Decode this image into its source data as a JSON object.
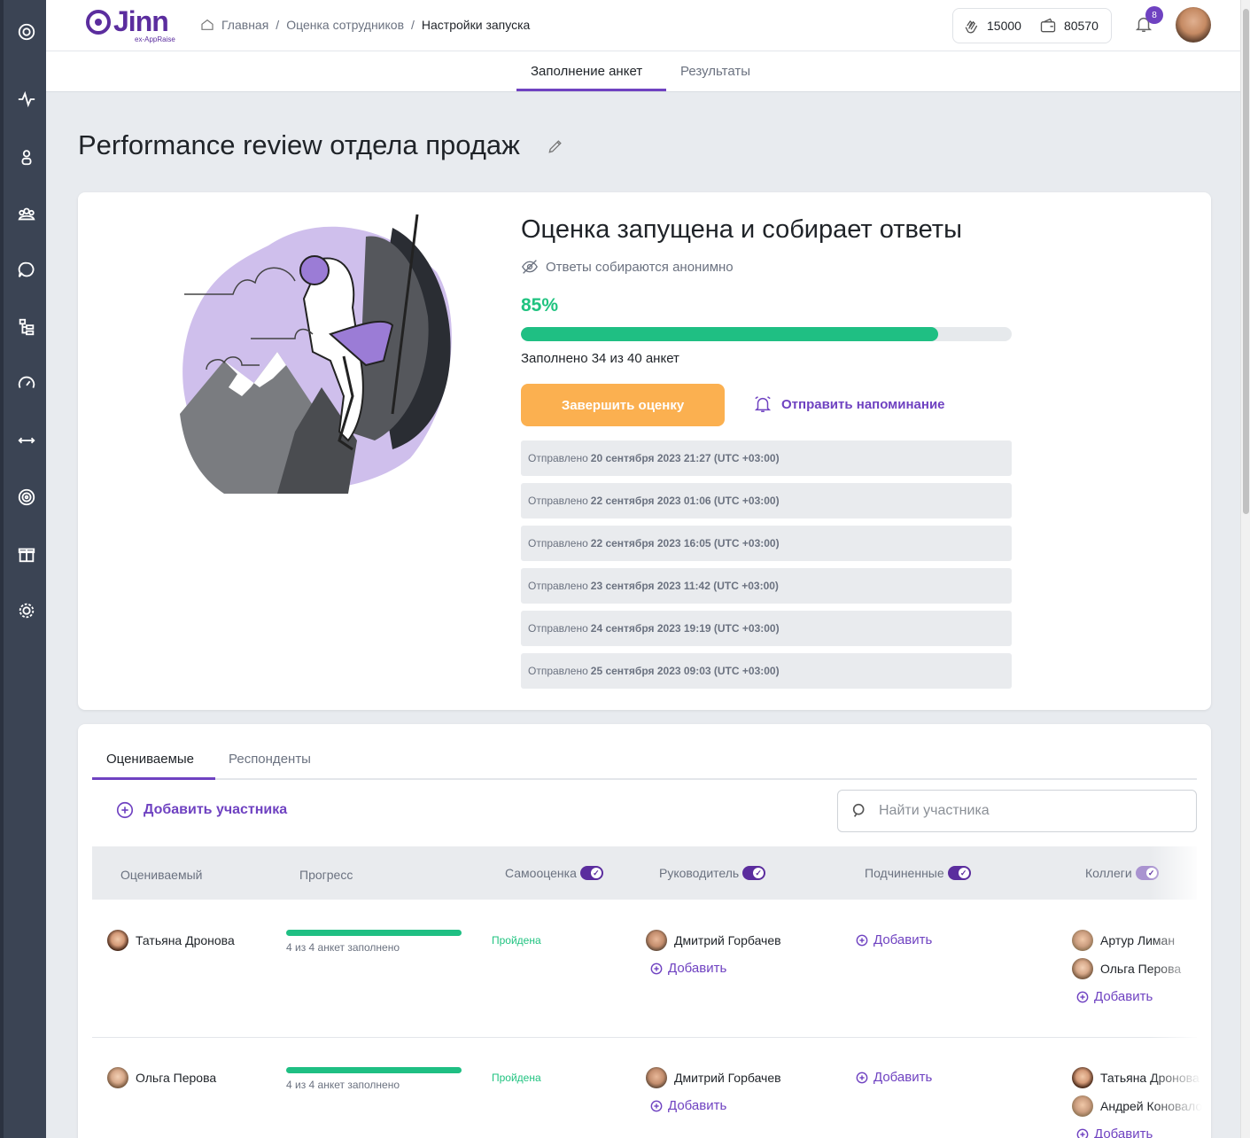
{
  "sidebar": {
    "icons": [
      "logo-spiral-icon",
      "pulse-icon",
      "user-icon",
      "team-icon",
      "chat-icon",
      "org-structure-icon",
      "speedometer-icon",
      "sync-icon",
      "target-icon",
      "gift-icon",
      "settings-icon"
    ]
  },
  "header": {
    "logo_text": "Jinn",
    "logo_sub": "ex-AppRaise",
    "breadcrumb": {
      "home": "Главная",
      "sep": "/",
      "section": "Оценка сотрудников",
      "current": "Настройки запуска"
    },
    "balance_claps": "15000",
    "balance_wallet": "80570",
    "notifications_count": "8"
  },
  "subnav": {
    "tabs": [
      {
        "label": "Заполнение анкет",
        "active": true
      },
      {
        "label": "Результаты",
        "active": false
      }
    ]
  },
  "page_title": "Performance review отдела продаж",
  "status": {
    "title": "Оценка запущена и собирает ответы",
    "anonymous_note": "Ответы собираются анонимно",
    "percent_label": "85%",
    "progress_fraction": 0.85,
    "filled_text": "Заполнено 34 из 40 анкет",
    "finish_button": "Завершить оценку",
    "remind_button": "Отправить напоминание"
  },
  "sent_log": {
    "prefix": "Отправлено",
    "entries": [
      "20 сентября 2023 21:27 (UTC +03:00)",
      "22 сентября 2023 01:06 (UTC +03:00)",
      "22 сентября 2023 16:05 (UTC +03:00)",
      "23 сентября 2023 11:42 (UTC +03:00)",
      "24 сентября 2023 19:19 (UTC +03:00)",
      "25 сентября 2023 09:03 (UTC +03:00)"
    ]
  },
  "participants": {
    "tabs": [
      {
        "label": "Оцениваемые",
        "active": true
      },
      {
        "label": "Респонденты",
        "active": false
      }
    ],
    "add_label": "Добавить участника",
    "search_placeholder": "Найти участника",
    "columns": {
      "evaluated": "Оцениваемый",
      "progress": "Прогресс",
      "self": "Самооценка",
      "manager": "Руководитель",
      "subordinates": "Подчиненные",
      "colleagues": "Коллеги"
    },
    "add_link": "Добавить",
    "rows": [
      {
        "name": "Татьяна Дронова",
        "progress_text": "4 из 4 анкет заполнено",
        "progress_fraction": 1.0,
        "self_status": "Пройдена",
        "manager": "Дмитрий Горбачев",
        "colleagues": [
          "Артур Лиман",
          "Ольга Перова"
        ]
      },
      {
        "name": "Ольга Перова",
        "progress_text": "4 из 4 анкет заполнено",
        "progress_fraction": 1.0,
        "self_status": "Пройдена",
        "manager": "Дмитрий Горбачев",
        "colleagues": [
          "Татьяна Дронова",
          "Андрей Коновалов"
        ]
      }
    ]
  },
  "colors": {
    "accent": "#6f42c1",
    "success": "#1fbf83",
    "warning_button": "#fbb050",
    "sidebar": "#3b4454"
  }
}
